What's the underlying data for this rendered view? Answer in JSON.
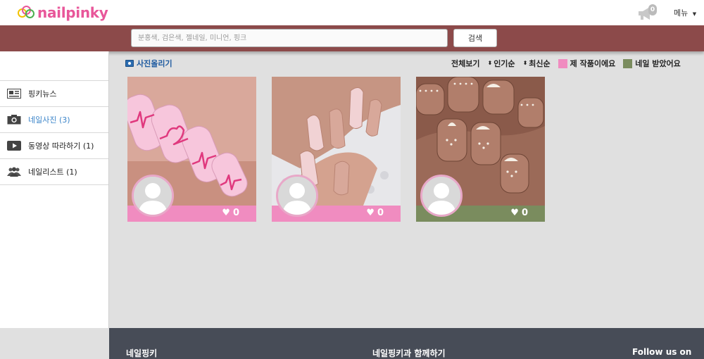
{
  "header": {
    "logo_text": "nailpinky",
    "notification_count": "0",
    "menu_label": "메뉴"
  },
  "search": {
    "placeholder": "분홍색, 검은색, 젤네일, 미니언, 핑크",
    "button_label": "검색"
  },
  "sidebar": {
    "items": [
      {
        "label": "핑키뉴스",
        "icon": "news-icon",
        "active": false
      },
      {
        "label": "네일사진 (3)",
        "icon": "camera-icon",
        "active": true
      },
      {
        "label": "동영상 따라하기 (1)",
        "icon": "video-icon",
        "active": false
      },
      {
        "label": "네일리스트 (1)",
        "icon": "users-icon",
        "active": false
      }
    ]
  },
  "toolbar": {
    "upload_label": "사진올리기",
    "view_all": "전체보기",
    "sort_popular": "인기순",
    "sort_recent": "최신순",
    "legend_mine": "제 작품이에요",
    "legend_received": "네일 받았어요",
    "legend_mine_color": "#f08cc0",
    "legend_received_color": "#7a8c5e"
  },
  "cards": [
    {
      "likes": "0",
      "type": "mine",
      "footer_color": "#f08cc0"
    },
    {
      "likes": "0",
      "type": "mine",
      "footer_color": "#f08cc0"
    },
    {
      "likes": "0",
      "type": "received",
      "footer_color": "#7a8c5e"
    }
  ],
  "footer": {
    "col1": "네일핑키",
    "col2": "네일핑키과 함께하기",
    "col3": "Follow us on"
  }
}
